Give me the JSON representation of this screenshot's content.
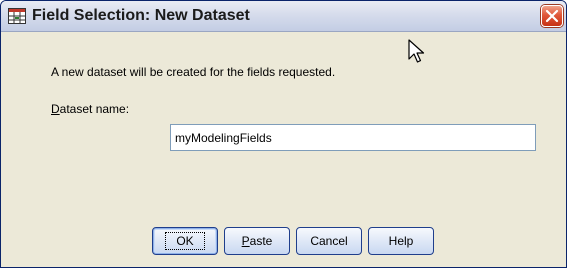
{
  "window": {
    "title": "Field Selection: New Dataset"
  },
  "dialog": {
    "info_text": "A new dataset will be created for the fields requested.",
    "dataset_label_prefix": "D",
    "dataset_label_rest": "ataset name:",
    "dataset_name_value": "myModelingFields"
  },
  "buttons": {
    "ok": "OK",
    "paste_prefix": "P",
    "paste_rest": "aste",
    "cancel": "Cancel",
    "help": "Help"
  },
  "icons": {
    "app": "dataset-grid-icon",
    "close": "close-icon",
    "cursor": "mouse-pointer-icon"
  },
  "colors": {
    "close_button": "#e0573a",
    "button_border": "#1f3e8c",
    "input_border": "#7f9db9"
  }
}
